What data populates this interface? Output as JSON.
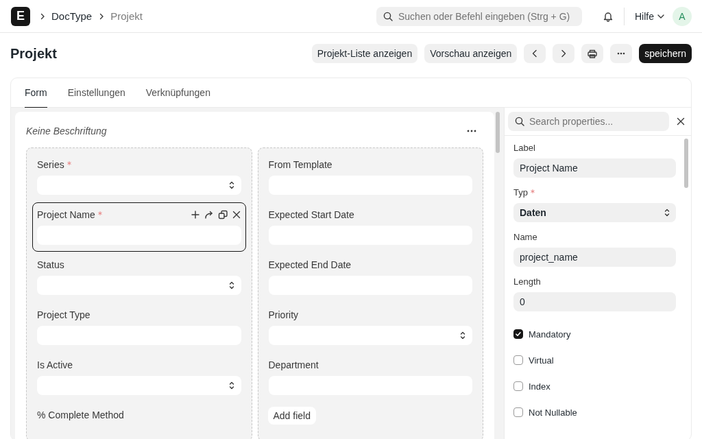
{
  "navbar": {
    "logo": "E",
    "breadcrumbs": [
      {
        "label": "DocType",
        "current": false
      },
      {
        "label": "Projekt",
        "current": true
      }
    ],
    "search": {
      "placeholder": "Suchen oder Befehl eingeben (Strg + G)"
    },
    "help": "Hilfe",
    "avatar": "A"
  },
  "page": {
    "title": "Projekt",
    "actions": [
      {
        "kind": "text",
        "label": "Projekt-Liste anzeigen"
      },
      {
        "kind": "text",
        "label": "Vorschau anzeigen"
      },
      {
        "kind": "prev"
      },
      {
        "kind": "next"
      },
      {
        "kind": "print"
      },
      {
        "kind": "more"
      },
      {
        "kind": "primary",
        "label": "speichern"
      }
    ]
  },
  "tabs": [
    {
      "label": "Form",
      "selected": true
    },
    {
      "label": "Einstellungen",
      "selected": false
    },
    {
      "label": "Verknüpfungen",
      "selected": false
    }
  ],
  "section": {
    "title": "Keine Beschriftung",
    "columns": [
      {
        "fields": [
          {
            "label": "Series",
            "required": true,
            "kind": "select",
            "selected": false
          },
          {
            "label": "Project Name",
            "required": true,
            "kind": "data",
            "selected": true
          },
          {
            "label": "Status",
            "required": false,
            "kind": "select",
            "selected": false
          },
          {
            "label": "Project Type",
            "required": false,
            "kind": "data",
            "selected": false
          },
          {
            "label": "Is Active",
            "required": false,
            "kind": "select",
            "selected": false
          },
          {
            "label": "% Complete Method",
            "required": false,
            "kind": "label",
            "selected": false
          }
        ]
      },
      {
        "fields": [
          {
            "label": "From Template",
            "required": false,
            "kind": "data",
            "selected": false
          },
          {
            "label": "Expected Start Date",
            "required": false,
            "kind": "data",
            "selected": false
          },
          {
            "label": "Expected End Date",
            "required": false,
            "kind": "data",
            "selected": false
          },
          {
            "label": "Priority",
            "required": false,
            "kind": "select",
            "selected": false
          },
          {
            "label": "Department",
            "required": false,
            "kind": "data",
            "selected": false
          }
        ],
        "add_button": "Add field"
      }
    ]
  },
  "properties": {
    "search": {
      "placeholder": "Search properties..."
    },
    "fields": [
      {
        "label": "Label",
        "required": false,
        "kind": "data",
        "value": "Project Name"
      },
      {
        "label": "Typ",
        "required": true,
        "kind": "select",
        "value": "Daten"
      },
      {
        "label": "Name",
        "required": false,
        "kind": "data",
        "value": "project_name"
      },
      {
        "label": "Length",
        "required": false,
        "kind": "data",
        "value": "0"
      }
    ],
    "checkboxes": [
      {
        "label": "Mandatory",
        "checked": true
      },
      {
        "label": "Virtual",
        "checked": false
      },
      {
        "label": "Index",
        "checked": false
      },
      {
        "label": "Not Nullable",
        "checked": false
      }
    ]
  }
}
